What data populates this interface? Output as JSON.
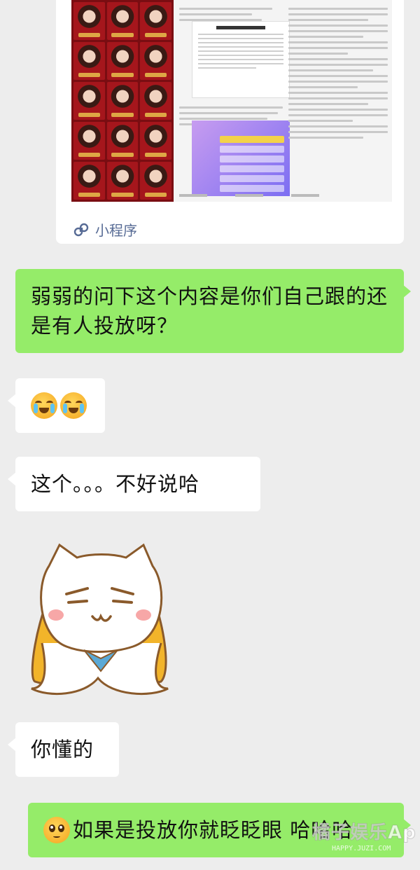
{
  "shared_card": {
    "label": "小程序",
    "icon": "mini-program-icon"
  },
  "messages": [
    {
      "side": "right",
      "text": "弱弱的问下这个内容是你们自己跟的还是有人投放呀？"
    },
    {
      "side": "left",
      "emojis": [
        "crying-face-emoji",
        "crying-face-emoji"
      ]
    },
    {
      "side": "left",
      "text": "这个。。。不好说哈"
    },
    {
      "side": "left",
      "sticker": "smug-cat-blanket-sticker"
    },
    {
      "side": "left",
      "text": "你懂的"
    },
    {
      "side": "right",
      "emoji": "pleading-face-emoji",
      "text": "如果是投放你就眨眨眼 哈哈哈"
    }
  ],
  "watermark": {
    "main": "橘子娱乐Ap",
    "sub": "HAPPY.JUZI.COM"
  },
  "colors": {
    "background": "#ededed",
    "sent_bubble": "#95ec69",
    "received_bubble": "#ffffff",
    "mini_program_label": "#576b95"
  }
}
